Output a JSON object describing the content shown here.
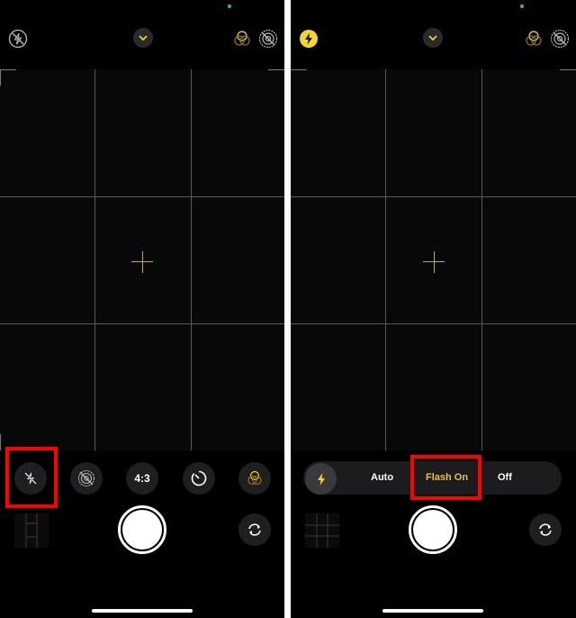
{
  "colors": {
    "accent_yellow": "#f5d430",
    "highlight_red": "#ff0000",
    "status_green": "#34c759"
  },
  "left_panel": {
    "top_bar": {
      "flash_icon": "flash-off-icon",
      "menu_icon": "chevron-down-icon",
      "filters_icon": "filters-icon",
      "live_photo_icon": "live-photo-off-icon"
    },
    "controls": [
      {
        "name": "flash",
        "icon": "flash-off-icon",
        "label": ""
      },
      {
        "name": "live-photo",
        "icon": "live-photo-off-icon",
        "label": ""
      },
      {
        "name": "aspect-ratio",
        "icon": "",
        "label": "4:3"
      },
      {
        "name": "timer",
        "icon": "timer-icon",
        "label": ""
      },
      {
        "name": "filters",
        "icon": "filters-icon",
        "label": ""
      }
    ]
  },
  "right_panel": {
    "top_bar": {
      "flash_icon": "flash-on-icon",
      "menu_icon": "chevron-down-icon",
      "filters_icon": "filters-icon",
      "live_photo_icon": "live-photo-off-icon"
    },
    "flash_options": [
      {
        "label": "Auto",
        "selected": false
      },
      {
        "label": "Flash On",
        "selected": true
      },
      {
        "label": "Off",
        "selected": false
      }
    ]
  }
}
